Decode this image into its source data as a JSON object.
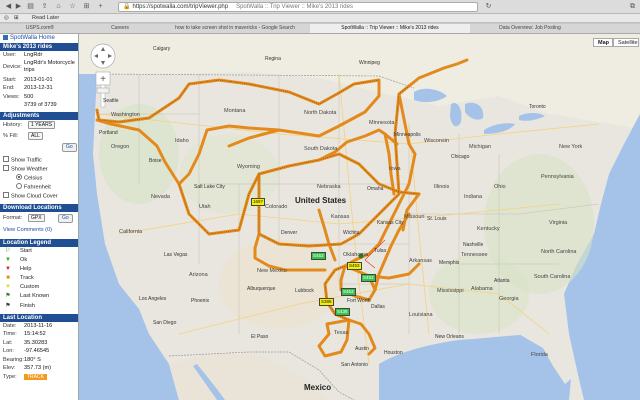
{
  "browser": {
    "url": "https://spotwalla.com/tripViewer.php",
    "page_title": "SpotWalla :: Trip Viewer :: Mike's 2013 rides",
    "bookmarks": [
      "Read Later",
      "USPS.com®",
      "Careers"
    ],
    "tabs": [
      "how to take screen shot in mavericks - Google Search",
      "SpotWalla :: Trip Viewer :: Mike's 2013 rides",
      "Data Overview: Job Posting"
    ]
  },
  "sidebar": {
    "home_link": "SpotWalla Home",
    "trip_title": "Mike's 2013 rides",
    "info": [
      {
        "k": "User:",
        "v": "LngRdr"
      },
      {
        "k": "Device:",
        "v": "LngRdr's Motorcycle trips"
      },
      {
        "k": "Start:",
        "v": "2013-01-01"
      },
      {
        "k": "End:",
        "v": "2013-12-31"
      },
      {
        "k": "Views:",
        "v": "500"
      },
      {
        "k": "",
        "v": "3739 of 3739"
      }
    ],
    "adjustments": {
      "header": "Adjustments",
      "history_label": "History:",
      "history_value": "1 YEARS",
      "fill_label": "% Fill:",
      "fill_value": "ALL",
      "go": "Go"
    },
    "options": {
      "show_traffic": "Show Traffic",
      "show_weather": "Show Weather",
      "celsius": "Celsius",
      "fahrenheit": "Fahrenheit",
      "show_cloud": "Show Cloud Cover"
    },
    "download": {
      "header": "Download Locations",
      "format_label": "Format:",
      "format_value": "GPX",
      "go": "Go",
      "view_comments": "View Comments (0)"
    },
    "legend": {
      "header": "Location Legend",
      "items": [
        "Start",
        "Ok",
        "Help",
        "Track",
        "Custom",
        "Last Known",
        "Finish"
      ]
    },
    "last_location": {
      "header": "Last Location",
      "rows": [
        {
          "k": "Date:",
          "v": "2013-11-16"
        },
        {
          "k": "Time:",
          "v": "15:14:52"
        },
        {
          "k": "Lat:",
          "v": "35.30283"
        },
        {
          "k": "Lon:",
          "v": "-97.46545"
        },
        {
          "k": "Bearing:",
          "v": "180° S"
        },
        {
          "k": "Elev:",
          "v": "357.73 (m)"
        }
      ],
      "type_label": "Type:",
      "type_value": "TRACK"
    }
  },
  "map": {
    "map_button": "Map",
    "satellite_button": "Satellite",
    "labels": {
      "country_us": "United States",
      "country_mx": "Mexico",
      "states": [
        "Washington",
        "Oregon",
        "Idaho",
        "Montana",
        "North Dakota",
        "Minnesota",
        "South Dakota",
        "Wyoming",
        "Nevada",
        "Utah",
        "Colorado",
        "Nebraska",
        "Kansas",
        "Iowa",
        "Illinois",
        "Missouri",
        "California",
        "Arizona",
        "New Mexico",
        "Oklahoma",
        "Arkansas",
        "Texas",
        "Louisiana",
        "Mississippi",
        "Alabama",
        "Georgia",
        "Tennessee",
        "Kentucky",
        "Indiana",
        "Ohio",
        "Michigan",
        "Wisconsin",
        "Florida",
        "Virginia",
        "North Carolina",
        "South Carolina",
        "Pennsylvania",
        "New York"
      ],
      "cities": [
        "Denver",
        "Albuquerque",
        "Dallas",
        "Houston",
        "San Antonio",
        "Austin",
        "Fort Worth",
        "El Paso",
        "Kansas City",
        "Omaha",
        "Chicago",
        "Minneapolis",
        "St. Louis",
        "Memphis",
        "Atlanta",
        "Phoenix",
        "Las Vegas",
        "Salt Lake City",
        "Seattle",
        "Portland",
        "Los Angeles",
        "San Diego",
        "New Orleans",
        "Nashville",
        "Wichita",
        "Tulsa",
        "Lubbock",
        "Boise",
        "Calgary",
        "Regina",
        "Winnipeg",
        "Toronto"
      ],
      "tags": [
        "1697",
        "S453",
        "S453",
        "S453",
        "S453",
        "S388",
        "S436"
      ]
    }
  },
  "colors": {
    "sidebar_header": "#1f4e93",
    "track": "#e38a1c",
    "tag_yellow": "#f5f000",
    "tag_green": "#34c34a",
    "type_badge": "#f39a1e"
  }
}
